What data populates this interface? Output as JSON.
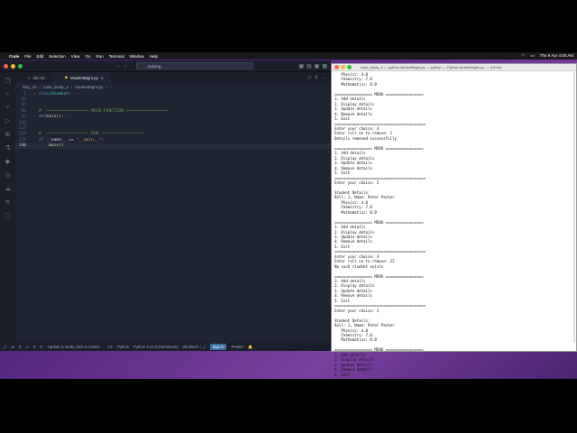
{
  "menubar": {
    "app": "Code",
    "items": [
      "File",
      "Edit",
      "Selection",
      "View",
      "Go",
      "Run",
      "Terminal",
      "Window",
      "Help"
    ],
    "datetime": "Thu 9 Apr  4:00 AM"
  },
  "vscode": {
    "search_text": "training",
    "tabs": [
      {
        "label": "title.txt"
      },
      {
        "label": "studentMgnt.py"
      }
    ],
    "breadcrumb": [
      "Day_10",
      "case_study_4",
      "studentMgnt.py",
      "..."
    ],
    "code_lines": [
      {
        "n": "1",
        "text": "class Student:"
      },
      {
        "n": "84",
        "text": ""
      },
      {
        "n": "85",
        "text": ""
      },
      {
        "n": "86",
        "text": "# ----------------- MAIN FUNCTION -----------------"
      },
      {
        "n": "87",
        "text": "def main():"
      },
      {
        "n": "126",
        "text": ""
      },
      {
        "n": "127",
        "text": ""
      },
      {
        "n": "128",
        "text": "# ----------------- RUN ---------------"
      },
      {
        "n": "129",
        "text": "if __name__ == \"__main__\":"
      },
      {
        "n": "130",
        "text": "    main()"
      }
    ],
    "status": {
      "warnings": "0",
      "errors": "0",
      "message": "Update is ready, click to restart.",
      "eol": "LF",
      "lang": "Python",
      "interpreter": "Python 3.12.8 (homebrew)",
      "ext": "Windsurf: (...)",
      "signin": "Sign in",
      "prettier": "Prettier"
    }
  },
  "terminal": {
    "title": "case_study_4 — python studentMgnt.py — python — Python studentMgnt.py — 113×64",
    "output": "   Physics: 4.0\n   Chemistry: 7.0\n   Mathematics: 8.0\n\n================= MENU =================\n1. Add details\n2. Display details\n3. Update details\n4. Remove details\n5. Exit\n=========================================\nEnter your choice: 4\nEnter roll no to remove: 1\nDetails removed successfully\n\n================= MENU =================\n1. Add details\n2. Display details\n3. Update details\n4. Remove details\n5. Exit\n=========================================\nEnter your choice: 2\n\nStudent Details:\nRoll: 1, Name: Peter Parker\n   Physics: 4.0\n   Chemistry: 7.0\n   Mathematics: 8.0\n\n================= MENU =================\n1. Add details\n2. Display details\n3. Update details\n4. Remove details\n5. Exit\n=========================================\nEnter your choice: 4\nEnter roll no to remove: 22\nNo such student exists\n\n================= MENU =================\n1. Add details\n2. Display details\n3. Update details\n4. Remove details\n5. Exit\n=========================================\nEnter your choice: 2\n\nStudent Details:\nRoll: 1, Name: Peter Parker\n   Physics: 4.0\n   Chemistry: 7.0\n   Mathematics: 8.0\n\n================= MENU =================\n1. Add details\n2. Display details\n3. Update details\n4. Remove details\n5. Exit\n=========================================\nEnter your choice: ▯"
  },
  "dock": {
    "apps": [
      "finder-icon",
      "launchpad-icon",
      "chrome-icon",
      "vscode-icon",
      "terminal-icon",
      "mail-icon",
      "trash-icon"
    ]
  }
}
